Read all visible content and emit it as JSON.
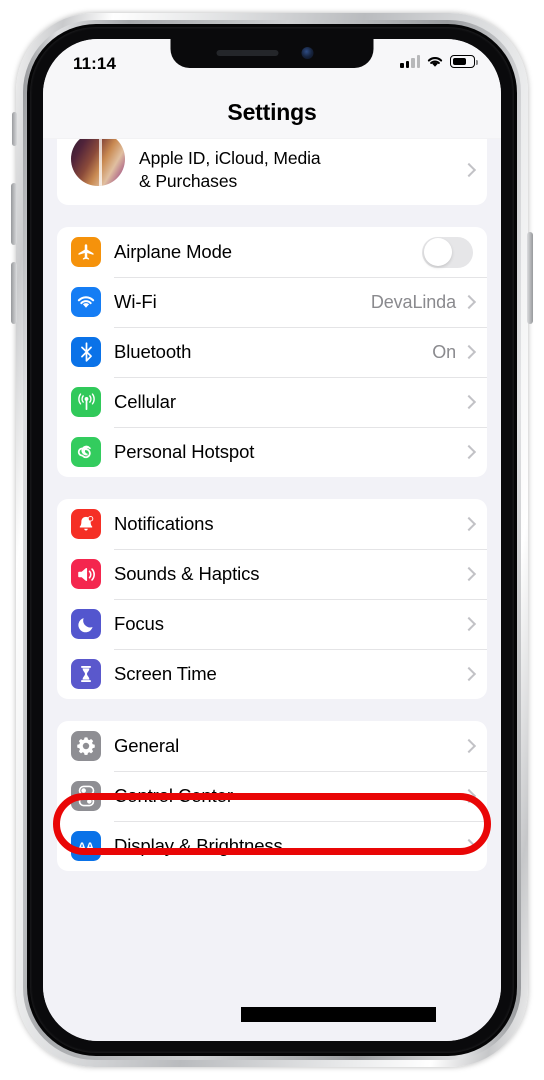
{
  "device": {
    "frame": "iphone",
    "body_color": "#c9cacc"
  },
  "status_bar": {
    "time": "11:14",
    "signal_bars_total": 4,
    "signal_bars_filled": 2,
    "wifi_icon": "wifi-icon",
    "battery_percent": 58
  },
  "nav": {
    "title": "Settings"
  },
  "apple_id": {
    "label": "Apple ID, iCloud, Media\n& Purchases",
    "avatar": "profile-photo"
  },
  "groups": [
    {
      "id": "connectivity",
      "rows": [
        {
          "label": "Airplane Mode",
          "icon": "airplane-icon",
          "icon_color": "#f5920b",
          "control": "toggle",
          "toggle_on": false
        },
        {
          "label": "Wi-Fi",
          "icon": "wifi-icon",
          "icon_color": "#157df4",
          "value": "DevaLinda",
          "control": "chevron"
        },
        {
          "label": "Bluetooth",
          "icon": "bluetooth-icon",
          "icon_color": "#0a72e8",
          "value": "On",
          "control": "chevron"
        },
        {
          "label": "Cellular",
          "icon": "cellular-icon",
          "icon_color": "#30c95a",
          "value": "",
          "control": "chevron"
        },
        {
          "label": "Personal Hotspot",
          "icon": "hotspot-icon",
          "icon_color": "#33cc5e",
          "value": "",
          "control": "chevron"
        }
      ]
    },
    {
      "id": "alerts",
      "rows": [
        {
          "label": "Notifications",
          "icon": "bell-icon",
          "icon_color": "#f52f25",
          "value": "",
          "control": "chevron"
        },
        {
          "label": "Sounds & Haptics",
          "icon": "speaker-icon",
          "icon_color": "#f4264e",
          "value": "",
          "control": "chevron"
        },
        {
          "label": "Focus",
          "icon": "moon-icon",
          "icon_color": "#5356ce",
          "value": "",
          "control": "chevron"
        },
        {
          "label": "Screen Time",
          "icon": "hourglass-icon",
          "icon_color": "#5a58cc",
          "value": "",
          "control": "chevron"
        }
      ]
    },
    {
      "id": "system",
      "rows": [
        {
          "label": "General",
          "icon": "gear-icon",
          "icon_color": "#8e8e93",
          "value": "",
          "control": "chevron",
          "highlighted": true
        },
        {
          "label": "Control Center",
          "icon": "control-center-icon",
          "icon_color": "#8e8e93",
          "value": "",
          "control": "chevron"
        },
        {
          "label": "Display & Brightness",
          "icon": "aa-icon",
          "icon_color": "#0a72e8",
          "value": "",
          "control": "chevron",
          "redacted": true
        }
      ]
    }
  ],
  "annotations": {
    "highlight_color": "#e90606",
    "highlight_target": "General",
    "redaction_color": "#000000",
    "redaction_target": "Display & Brightness"
  }
}
